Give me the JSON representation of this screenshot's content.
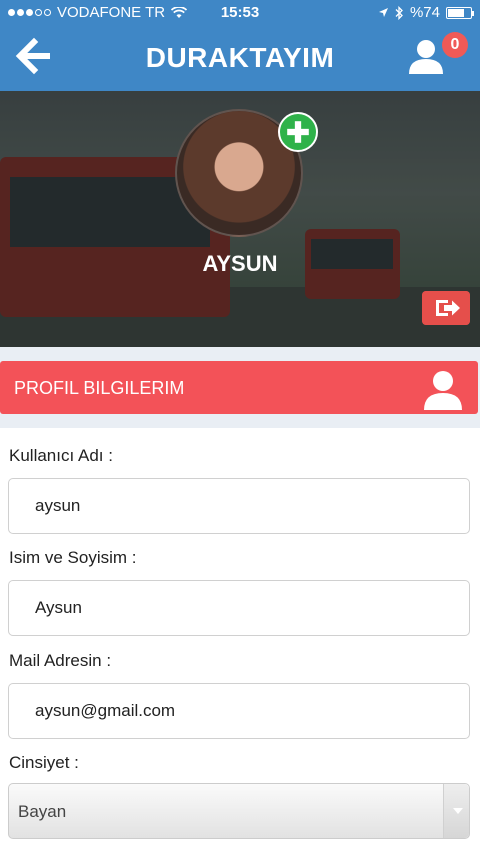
{
  "status_bar": {
    "carrier": "VODAFONE TR",
    "time": "15:53",
    "battery_text": "%74",
    "battery_level": 0.74
  },
  "nav": {
    "title": "DURAKTAYIM",
    "notification_count": "0"
  },
  "profile": {
    "username": "AYSUN"
  },
  "section": {
    "title": "PROFIL BILGILERIM"
  },
  "form": {
    "username_label": "Kullanıcı Adı :",
    "username_value": "aysun",
    "fullname_label": "Isim ve Soyisim :",
    "fullname_value": "Aysun",
    "email_label": "Mail Adresin :",
    "email_value": "aysun@gmail.com",
    "gender_label": "Cinsiyet :",
    "gender_value": "Bayan"
  },
  "colors": {
    "nav_blue": "#3f87c6",
    "section_red": "#f35258",
    "add_green": "#2fb24a",
    "badge_red": "#f05a57"
  },
  "icons": [
    "back-arrow-icon",
    "user-icon",
    "plus-icon",
    "logout-icon",
    "wifi-icon",
    "location-icon",
    "bluetooth-icon"
  ]
}
